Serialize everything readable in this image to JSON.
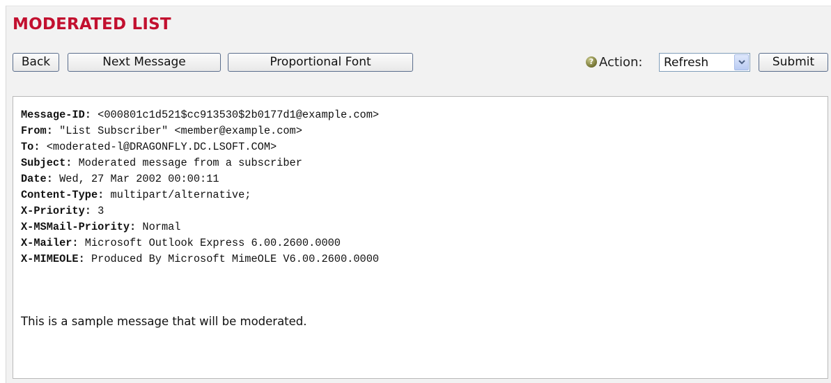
{
  "page": {
    "title": "MODERATED LIST"
  },
  "toolbar": {
    "back_label": "Back",
    "next_label": "Next Message",
    "font_label": "Proportional Font",
    "help_icon": "help-icon",
    "action_label": "Action:",
    "action_selected": "Refresh",
    "submit_label": "Submit"
  },
  "message": {
    "headers": [
      {
        "key": "Message-ID:",
        "value": " <000801c1d521$cc913530$2b0177d1@example.com>"
      },
      {
        "key": "From:",
        "value": " \"List Subscriber\" <member@example.com>"
      },
      {
        "key": "To:",
        "value": " <moderated-l@DRAGONFLY.DC.LSOFT.COM>"
      },
      {
        "key": "Subject:",
        "value": " Moderated message from a subscriber"
      },
      {
        "key": "Date:",
        "value": " Wed, 27 Mar 2002 00:00:11"
      },
      {
        "key": "Content-Type:",
        "value": " multipart/alternative;"
      },
      {
        "key": "X-Priority:",
        "value": " 3"
      },
      {
        "key": "X-MSMail-Priority:",
        "value": " Normal"
      },
      {
        "key": "X-Mailer:",
        "value": " Microsoft Outlook Express 6.00.2600.0000"
      },
      {
        "key": "X-MIMEOLE:",
        "value": " Produced By Microsoft MimeOLE V6.00.2600.0000"
      }
    ],
    "body": "This is a sample message that will be moderated."
  },
  "colors": {
    "title": "#c2102f",
    "panel_background": "#f2f2f2",
    "button_border": "#5a6d8c"
  }
}
